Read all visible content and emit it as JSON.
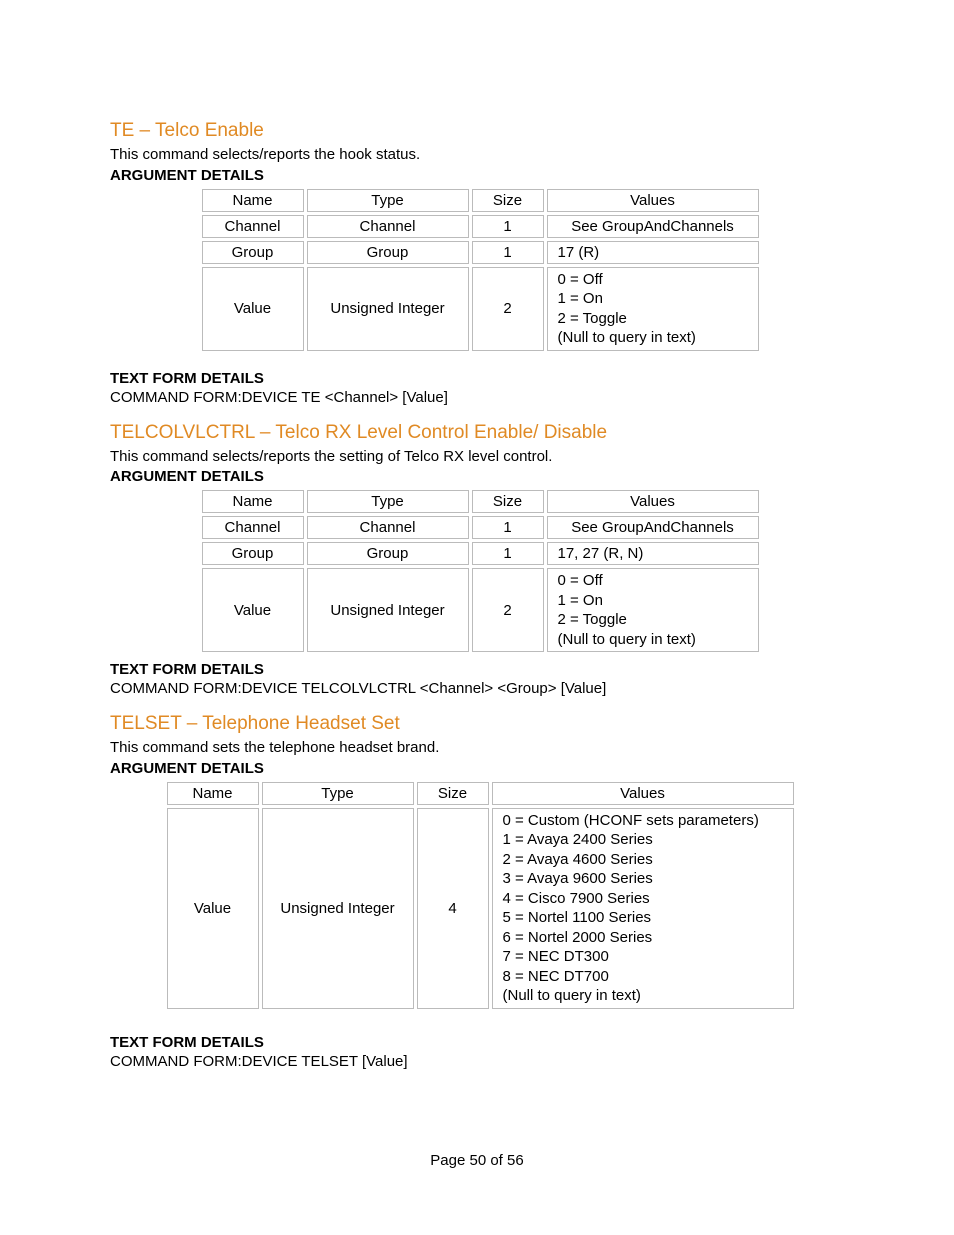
{
  "footer": {
    "text": "Page 50 of 56"
  },
  "labels": {
    "arg_details": "ARGUMENT DETAILS",
    "text_form_details": "TEXT FORM DETAILS",
    "col_name": "Name",
    "col_type": "Type",
    "col_size": "Size",
    "col_values": "Values"
  },
  "sections": {
    "te": {
      "title": "TE – Telco Enable",
      "desc": "This command selects/reports the hook status.",
      "text_form": "COMMAND FORM:DEVICE TE <Channel> [Value]",
      "rows": {
        "channel": {
          "name": "Channel",
          "type": "Channel",
          "size": "1",
          "values": "See GroupAndChannels"
        },
        "group": {
          "name": "Group",
          "type": "Group",
          "size": "1",
          "values": "17 (R)"
        },
        "value": {
          "name": "Value",
          "type": "Unsigned Integer",
          "size": "2",
          "v0": "0 = Off",
          "v1": "1 = On",
          "v2": "2 = Toggle",
          "v3": "(Null to query in text)"
        }
      }
    },
    "telcolvlctrl": {
      "title": "TELCOLVLCTRL – Telco RX Level Control Enable/ Disable",
      "desc": "This command selects/reports the setting of Telco RX level control.",
      "text_form": "COMMAND FORM:DEVICE TELCOLVLCTRL <Channel> <Group> [Value]",
      "rows": {
        "channel": {
          "name": "Channel",
          "type": "Channel",
          "size": "1",
          "values": "See GroupAndChannels"
        },
        "group": {
          "name": "Group",
          "type": "Group",
          "size": "1",
          "values": "17, 27 (R, N)"
        },
        "value": {
          "name": "Value",
          "type": "Unsigned Integer",
          "size": "2",
          "v0": "0 = Off",
          "v1": "1 = On",
          "v2": "2 = Toggle",
          "v3": "(Null to query in text)"
        }
      }
    },
    "telset": {
      "title": "TELSET – Telephone Headset Set",
      "desc": "This command sets the telephone headset brand.",
      "text_form": "COMMAND FORM:DEVICE TELSET [Value]",
      "rows": {
        "value": {
          "name": "Value",
          "type": "Unsigned Integer",
          "size": "4",
          "v0": "0 = Custom (HCONF sets parameters)",
          "v1": "1 = Avaya 2400 Series",
          "v2": "2 = Avaya 4600 Series",
          "v3": "3 = Avaya 9600 Series",
          "v4": "4 = Cisco 7900 Series",
          "v5": "5 = Nortel 1100 Series",
          "v6": "6 = Nortel 2000 Series",
          "v7": "7 = NEC DT300",
          "v8": "8 = NEC DT700",
          "v9": "(Null to query in text)"
        }
      }
    }
  }
}
